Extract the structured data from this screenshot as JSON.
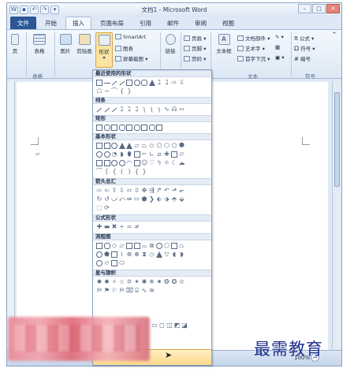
{
  "window": {
    "title": "文档1 - Microsoft Word",
    "controls": [
      "–",
      "□",
      "✕"
    ]
  },
  "quick_access": [
    "W",
    "💾",
    "↶",
    "↷",
    "▾"
  ],
  "tabs": [
    "文件",
    "开始",
    "插入",
    "页面布局",
    "引用",
    "邮件",
    "审阅",
    "视图"
  ],
  "ribbon": {
    "page": "页",
    "table": "表格",
    "picture": "图片",
    "clip_art": "剪贴画",
    "shapes": "形状",
    "smartart": "SmartArt",
    "chart": "图表",
    "screenshot": "屏幕截图",
    "link": "链接",
    "header": "页眉",
    "footer": "页脚",
    "page_number": "页码",
    "text_box": "文本框",
    "doc_parts": "文档部件",
    "wordart": "艺术字",
    "dropcap": "首字下沉",
    "equation": "公式",
    "symbol": "符号",
    "number": "编号",
    "group_table": "表格",
    "group_text": "文本",
    "group_symbol": "符号"
  },
  "gallery": {
    "sections": [
      "最近使用的形状",
      "线条",
      "矩形",
      "基本形状",
      "箭头总汇",
      "公式形状",
      "流程图",
      "星与旗帜"
    ]
  },
  "status": {
    "zoom": "100%"
  },
  "watermark": "最需教育"
}
